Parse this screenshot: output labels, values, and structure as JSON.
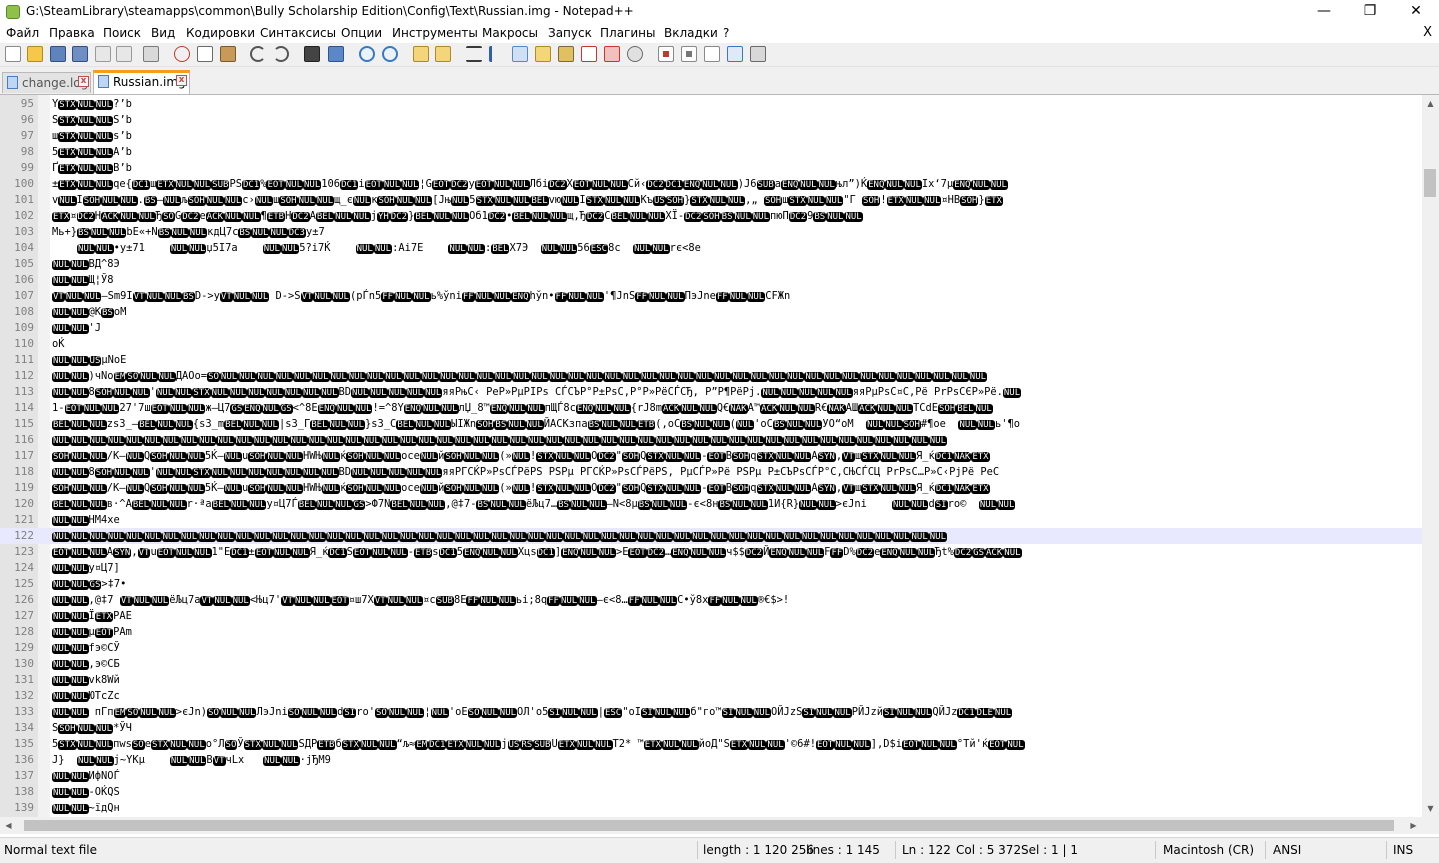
{
  "window": {
    "title": "G:\\SteamLibrary\\steamapps\\common\\Bully Scholarship Edition\\Config\\Text\\Russian.img - Notepad++",
    "minimize": "—",
    "maximize": "❐",
    "close": "✕"
  },
  "menu": {
    "items": [
      "Файл",
      "Правка",
      "Поиск",
      "Вид",
      "Кодировки",
      "Синтаксисы",
      "Опции",
      "Инструменты",
      "Макросы",
      "Запуск",
      "Плагины",
      "Вкладки",
      "?"
    ],
    "close_doc": "X"
  },
  "toolbar": {
    "icons": [
      "new-file-icon",
      "open-file-icon",
      "save-icon",
      "save-all-icon",
      "close-icon",
      "close-all-icon",
      "print-icon",
      "cut-icon",
      "copy-icon",
      "paste-icon",
      "undo-icon",
      "redo-icon",
      "find-icon",
      "replace-icon",
      "zoom-in-icon",
      "zoom-out-icon",
      "sync-vertical-icon",
      "sync-horizontal-icon",
      "word-wrap-icon",
      "show-all-chars-icon",
      "indent-guide-icon",
      "udl-icon",
      "doc-map-icon",
      "function-list-icon",
      "folder-workspace-icon",
      "monitoring-icon",
      "record-macro-icon",
      "stop-macro-icon",
      "play-macro-icon",
      "run-macro-multiple-icon",
      "save-macro-icon"
    ]
  },
  "tabs": [
    {
      "label": "change.log",
      "active": false
    },
    {
      "label": "Russian.img",
      "active": true
    }
  ],
  "editor": {
    "current_line": 122,
    "lines": [
      {
        "n": "95",
        "t": "Y<STX><NUL><NUL>?’b"
      },
      {
        "n": "96",
        "t": "S<STX><NUL><NUL>S’b"
      },
      {
        "n": "97",
        "t": "ш<STX><NUL><NUL>s’b"
      },
      {
        "n": "98",
        "t": "5<ETX><NUL><NUL>A’b"
      },
      {
        "n": "99",
        "t": "Ґ<ETX><NUL><NUL>B’b"
      },
      {
        "n": "100",
        "t": "±<ETX><NUL><NUL>qe{<DC1>ш<ETX><NUL><NUL><SUB>PS<DC1>%<EOT><NUL><NUL>106<DC1>i<EOT><NUL><NUL>¦G<EOT><DC2>y<EOT><NUL><NUL>Лбi<DC2>X<EOT><NUL><NUL>Сй‹<DC2><DC1><ENQ><NUL><NUL>)J6<SUB>a<ENQ><NUL><NUL>њл”)Ќ<ENQ><NUL><NUL>Ix‘7µ<ENQ><NUL><NUL>"
      },
      {
        "n": "101",
        "t": "v<NUL>I<SOH><NUL><NUL>.<BS>—<NUL>љ<SOH><NUL><NUL>c›<NUL>ш<SOH><NUL><NUL>щ_є<NUL>к<SOH><NUL><NUL>[Jњ<NUL>5<STX><NUL><NUL><BEL>vю<NUL>I<STX><NUL><NUL>Къ<US><SOH>}<STX><NUL><NUL>,„ <SOH>ш<STX><NUL><NUL>\"Г <SOH>!<ETX><NUL><NUL>¤HB<SOH>}<ETX>"
      },
      {
        "n": "102",
        "t": "<ETX>¤<DC2>H<ACK><NUL><NUL>Ђ<SO>G<DC2>e<ACK><NUL><NUL>¶<ETB>Н<DC2>A<BEL><NUL><NUL>ј<YH><DC2>}<BEL><NUL><NUL>Об1<DC2>•<BEL><NUL><NUL>щ,Ђ<DC2>C<BEL><NUL><NUL>XЇ-<DC2><SOH><BS><NUL><NUL>пюП<DC2>9<BS><NUL><NUL>"
      },
      {
        "n": "103",
        "t": "Mь+}<BS><NUL><NUL>bE«+N<BS><NUL><NUL>кдЦ7c<BS><NUL><NUL><DC3>y±7"
      },
      {
        "n": "104",
        "t": "    <NUL><NUL>•y±71    <NUL><NUL>џ5I7a    <NUL><NUL>5?i7Ќ    <NUL><NUL>:Ai7E    <NUL><NUL>:<BEL>X7Э  <NUL><NUL>56<ESC>8c  <NUL><NUL>rє<8e"
      },
      {
        "n": "105",
        "t": "<NUL><NUL>ВД^8Э"
      },
      {
        "n": "106",
        "t": "<NUL><NUL>Щ¦Ў8"
      },
      {
        "n": "107",
        "t": "<VT><NUL><NUL>—Sm9I<VT><NUL><NUL><BS>D->y<VT><NUL><NUL> D->S<VT><NUL><NUL>(pЃn5<FF><NUL><NUL>ь%ўni<FF><NUL><NUL><ENQ>hўn•<FF><NUL><NUL>'¶JnS<FF><NUL><NUL>ПэJne<FF><NUL><NUL>CFЖn"
      },
      {
        "n": "108",
        "t": "<NUL><NUL>@K<BS>oM"
      },
      {
        "n": "109",
        "t": "<NUL><NUL>'J"
      },
      {
        "n": "110",
        "t": "oЌ"
      },
      {
        "n": "111",
        "t": "<NUL><NUL><US>µNoE"
      },
      {
        "n": "112",
        "t": "<NUL><NUL>)чNo<EM><SO><NUL><NUL>ДАОо=<SO><NUL><NUL><NUL><NUL><NUL><NUL><NUL><NUL><NUL><NUL><NUL><NUL><NUL><NUL><NUL><NUL><NUL><NUL><NUL><NUL><NUL><NUL><NUL><NUL><NUL><NUL><NUL><NUL><NUL><NUL><NUL><NUL><NUL><NUL><NUL><NUL><NUL><NUL><NUL><NUL><NUL><NUL>"
      },
      {
        "n": "113",
        "t": "<NUL><NUL>8<SOH><NUL><NUL>'<NUL><NUL><STX><NUL><NUL><NUL><NUL><NUL><NUL><NUL>BD<NUL><NUL><NUL><NUL><NUL>яяРњС‹ PeP»PµPIPs СЃСЪР°P±PsC,Р°Р»РёСЃСЂ, Р”Р¶РёРј.<NUL><NUL><NUL><NUL><NUL>яяРµPsC¤C,Рё PrPsСЄР»Рё.<NUL>"
      },
      {
        "n": "114",
        "t": "1-<EOT><NUL><NUL>27'7ш<EOT><NUL><NUL>ж—Ц7<GS><ENQ><NUL><GS><^8E<ENQ><NUL><NUL>!=^8Y<ENQ><NUL><NUL>лЏ_8™<ENQ><NUL><NUL>пЩЃ8c<ENQ><NUL><NUL>{rJ8m<ACK><NUL><NUL>Q€<NAK>A™<ACK><NUL><NUL>R€<NAK>АШ<ACK><NUL><NUL>TCdE<SOH><BEL><NUL>"
      },
      {
        "n": "115",
        "t": "<BEL><NUL><NUL>zs3_—<BEL><NUL><NUL>{s3_m<BEL><NUL><NUL>|s3_Г<BEL><NUL><NUL>}s3_C<BEL><NUL><NUL>ЫIЖn<SOH><BS><NUL><NUL>ЙACKзпа<BS><NUL><NUL><ETB>(,oC<BS><NUL><NUL>(<NUL>'oC<BS><NUL><NUL>УО“oM  <NUL><NUL><SOH>#¶oe  <NUL><NUL>ь'¶o"
      },
      {
        "n": "116",
        "t": "<NUL><NUL><NUL><NUL><NUL><NUL><NUL><NUL><NUL><NUL><NUL><NUL><NUL><NUL><NUL><NUL><NUL><NUL><NUL><NUL><NUL><NUL><NUL><NUL><NUL><NUL><NUL><NUL><NUL><NUL><NUL><NUL><NUL><NUL><NUL><NUL><NUL><NUL><NUL><NUL><NUL><NUL><NUL><NUL><NUL><NUL><NUL><NUL><NUL>"
      },
      {
        "n": "117",
        "t": "<SOH><NUL><NUL>/K—<NUL>Q<SOH><NUL><NUL>5Ќ—<NUL>u<SOH><NUL><NUL>HWЊ<NUL>ќ<SOH><NUL><NUL>oce<NUL>й<SOH><NUL><NUL>(»<NUL>!<STX><NUL><NUL>O<DC2>\"<SOH>Q<STX><NUL><NUL>-<EOT>B<SOH>q<STX><NUL><NUL>A<SYN>,<VT>ш<STX><NUL><NUL>Я_ќ<DC1><NAK><ETX>"
      },
      {
        "n": "118",
        "t": "<NUL><NUL>8<SOH><NUL><NUL>'<NUL><NUL><STX><NUL><NUL><NUL><NUL><NUL><NUL><NUL>BD<NUL><NUL><NUL><NUL><NUL>яяРГСЌР»PsCЃРёPS PSPµ РГСЌР»PsCЃРёPS, PµСЃР»Рё PSPµ P±СЪPsСЃР°С,СЊСЃСЦ PrPsC…P»C‹PjРё PeC"
      },
      {
        "n": "119",
        "t": "<SOH><NUL><NUL>/K—<NUL>Q<SOH><NUL><NUL>5Ќ—<NUL>u<SOH><NUL><NUL>HWЊ<NUL>ќ<SOH><NUL><NUL>oce<NUL>й<SOH><NUL><NUL>(»<NUL>!<STX><NUL><NUL>O<DC2>\"<SOH>Q<STX><NUL><NUL>-<EOT>B<SOH>q<STX><NUL><NUL>A<SYN>,<VT>ш<STX><NUL><NUL>Я_ќ<DC1><NAK><ETX>"
      },
      {
        "n": "120",
        "t": "<BEL><NUL><NUL>в·^A<BEL><NUL><NUL>r·ªa<BEL><NUL><NUL>y¤Ц7Ѓ<BEL><NUL><NUL><GS>>Ф7N<BEL><NUL><NUL>,@‡7-<BS><NUL><NUL>ёЉц7…<BS><NUL><NUL>—N<8µ<BS><NUL><NUL>-є<8н<BS><NUL><NUL>1И{R}<NUL><NUL>>єJni    <NUL><NUL>d<SI>ro©  <NUL><NUL>"
      },
      {
        "n": "121",
        "t": "<NUL><NUL>НМ4xe"
      },
      {
        "n": "122",
        "t": "<NUL><NUL><NUL><NUL><NUL><NUL><NUL><NUL><NUL><NUL><NUL><NUL><NUL><NUL><NUL><NUL><NUL><NUL><NUL><NUL><NUL><NUL><NUL><NUL><NUL><NUL><NUL><NUL><NUL><NUL><NUL><NUL><NUL><NUL><NUL><NUL><NUL><NUL><NUL><NUL><NUL><NUL><NUL><NUL><NUL><NUL><NUL><NUL><NUL>"
      },
      {
        "n": "123",
        "t": "<EOT><NUL><NUL>A<SYN>,<VT>u<EOT><NUL><NUL>1\"E<DC1>±<EOT><NUL><NUL>Я_ќ<DC1>S<EOT><NUL><NUL>-<ETB>s<DC1>5<ENQ><NUL><NUL>Хцs<DC1>]<ENQ><NUL><NUL>>Е<EOT><DC2>…<ENQ><NUL><NUL>ч$$<DC2>Й<ENQ><NUL><NUL>F<FF>D%<DC2>e<ENQ><NUL><NUL>Ђt%<DC2><GS><ACK><NUL>"
      },
      {
        "n": "124",
        "t": "<NUL><NUL>y¤Ц7]"
      },
      {
        "n": "125",
        "t": "<NUL><NUL><GS>>‡7•"
      },
      {
        "n": "126",
        "t": "<NUL><NUL>,@‡7 <VT><NUL><NUL>ёЉц7a<VT><NUL><NUL><Њц7'<VT><NUL><NUL><EOT>¤ш7X<VT><NUL><NUL>¤c<SUB>8E<FF><NUL><NUL>ьi;8q<FF><NUL><NUL>—є<8…<FF><NUL><NUL>C•ў8x<FF><NUL><NUL>®€$>!"
      },
      {
        "n": "127",
        "t": "<NUL><NUL>Ї<ETX>PAE"
      },
      {
        "n": "128",
        "t": "<NUL><NUL>µ<EOT>PAm"
      },
      {
        "n": "129",
        "t": "<NUL><NUL>fэ©CЎ"
      },
      {
        "n": "130",
        "t": "<NUL><NUL>,э©CБ"
      },
      {
        "n": "131",
        "t": "<NUL><NUL>vk8Wй"
      },
      {
        "n": "132",
        "t": "<NUL><NUL>ЮTcZc"
      },
      {
        "n": "133",
        "t": "<NUL><NUL> пГп<EM><SO><NUL><NUL>>єJn)<SO><NUL><NUL>ЛэJni<SO><NUL><NUL>d<SI>ro'<SO><NUL><NUL>¦<NUL>'oE<SO><NUL><NUL>ОЛ'o5<SI><NUL><NUL>|<ESC>\"oI<SI><NUL><NUL>б\"го™<SI><NUL><NUL>ОЙJzS<SI><NUL><NUL>РЙJzй<SI><NUL><NUL>QЙJz<DC1><DLE><NUL>"
      },
      {
        "n": "134",
        "t": "S<SOH><NUL><NUL>*ЎЧ"
      },
      {
        "n": "135",
        "t": "5<STX><NUL><NUL>пws<SO>e<STX><NUL><NUL>o°Л<SO>Ў<STX><NUL><NUL>SДР<ETB>б<STX><NUL><NUL>“љ≈<EM><DC1><ETX><NUL><NUL>ј<US><RS><SUB>U<ETX><NUL><NUL>T2* ™<ETX><NUL><NUL>йоД\"S<ETX><NUL><NUL>'©6#!<EOT><NUL><NUL>],D$i<EOT><NUL><NUL>°Tй'ќ<EOT><NUL>"
      },
      {
        "n": "136",
        "t": "J}  <NUL><NUL>ј~YKµ    <NUL><NUL>B<VT>чLx   <NUL><NUL>·jЂM9"
      },
      {
        "n": "137",
        "t": "<NUL><NUL>ИфNOЃ"
      },
      {
        "n": "138",
        "t": "<NUL><NUL>-OЌQS"
      },
      {
        "n": "139",
        "t": "<NUL><NUL>~їдQн"
      }
    ]
  },
  "status": {
    "type": "Normal text file",
    "length": "length : 1 120 256",
    "lines": "lines : 1 145",
    "ln": "Ln : 122",
    "col": "Col : 5 372",
    "sel": "Sel : 1 | 1",
    "eol": "Macintosh (CR)",
    "encoding": "ANSI",
    "mode": "INS"
  }
}
